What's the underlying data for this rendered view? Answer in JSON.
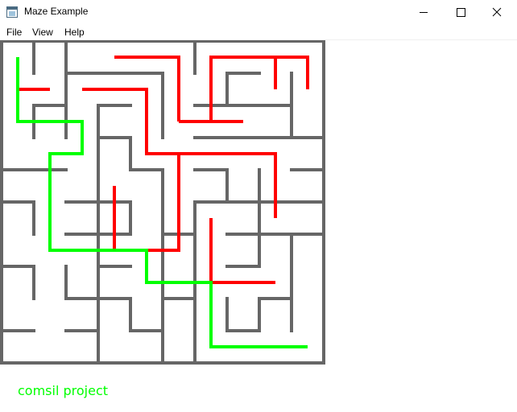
{
  "window": {
    "title": "Maze Example",
    "controls": {
      "minimize": "minimize",
      "maximize": "maximize",
      "close": "close"
    }
  },
  "menu": {
    "file": "File",
    "view": "View",
    "help": "Help"
  },
  "footer": {
    "text": "comsil project"
  },
  "colors": {
    "wall": "#666666",
    "solution_path": "#00ff00",
    "explored_path": "#ff0000",
    "footer_text": "#00ff00"
  },
  "maze": {
    "rows": 10,
    "cols": 10,
    "solution_path": [
      [
        0,
        0
      ],
      [
        0,
        1
      ],
      [
        0,
        2
      ],
      [
        1,
        2
      ],
      [
        2,
        2
      ],
      [
        2,
        3
      ],
      [
        1,
        3
      ],
      [
        1,
        4
      ],
      [
        1,
        5
      ],
      [
        1,
        6
      ],
      [
        2,
        6
      ],
      [
        3,
        6
      ],
      [
        4,
        6
      ],
      [
        4,
        7
      ],
      [
        5,
        7
      ],
      [
        6,
        7
      ],
      [
        6,
        8
      ],
      [
        6,
        9
      ],
      [
        7,
        9
      ],
      [
        8,
        9
      ],
      [
        9,
        9
      ]
    ],
    "explored_segments": [
      [
        [
          0,
          1
        ],
        [
          1,
          1
        ]
      ],
      [
        [
          2,
          1
        ],
        [
          3,
          1
        ],
        [
          4,
          1
        ],
        [
          4,
          2
        ],
        [
          4,
          3
        ],
        [
          5,
          3
        ],
        [
          6,
          3
        ],
        [
          7,
          3
        ],
        [
          8,
          3
        ],
        [
          8,
          4
        ],
        [
          8,
          5
        ]
      ],
      [
        [
          5,
          3
        ],
        [
          5,
          4
        ],
        [
          5,
          5
        ],
        [
          5,
          6
        ],
        [
          4,
          6
        ],
        [
          4,
          7
        ]
      ],
      [
        [
          3,
          4
        ],
        [
          3,
          5
        ],
        [
          3,
          6
        ]
      ],
      [
        [
          5,
          2
        ],
        [
          6,
          2
        ],
        [
          6,
          1
        ],
        [
          6,
          0
        ],
        [
          7,
          0
        ],
        [
          8,
          0
        ]
      ],
      [
        [
          5,
          1
        ],
        [
          5,
          0
        ],
        [
          4,
          0
        ],
        [
          3,
          0
        ]
      ],
      [
        [
          8,
          0
        ],
        [
          8,
          1
        ]
      ],
      [
        [
          5,
          1
        ],
        [
          5,
          2
        ]
      ],
      [
        [
          6,
          0
        ],
        [
          9,
          0
        ],
        [
          9,
          1
        ]
      ],
      [
        [
          5,
          2
        ],
        [
          7,
          2
        ]
      ],
      [
        [
          6,
          7
        ],
        [
          6,
          6
        ],
        [
          6,
          5
        ]
      ],
      [
        [
          6,
          7
        ],
        [
          8,
          7
        ]
      ]
    ],
    "walls": [
      [
        [
          0,
          0
        ],
        [
          10,
          0
        ]
      ],
      [
        [
          0,
          10
        ],
        [
          10,
          10
        ]
      ],
      [
        [
          0,
          0
        ],
        [
          0,
          10
        ]
      ],
      [
        [
          10,
          0
        ],
        [
          10,
          10
        ]
      ],
      [
        [
          1,
          0
        ],
        [
          1,
          1
        ]
      ],
      [
        [
          2,
          0
        ],
        [
          2,
          3
        ]
      ],
      [
        [
          2,
          1
        ],
        [
          5,
          1
        ]
      ],
      [
        [
          3,
          2
        ],
        [
          3,
          10
        ]
      ],
      [
        [
          1,
          2
        ],
        [
          2,
          2
        ]
      ],
      [
        [
          1,
          2
        ],
        [
          1,
          3
        ]
      ],
      [
        [
          3,
          2
        ],
        [
          4,
          2
        ]
      ],
      [
        [
          5,
          1
        ],
        [
          5,
          3
        ]
      ],
      [
        [
          6,
          0
        ],
        [
          6,
          1
        ]
      ],
      [
        [
          7,
          1
        ],
        [
          8,
          1
        ]
      ],
      [
        [
          7,
          1
        ],
        [
          7,
          2
        ]
      ],
      [
        [
          6,
          2
        ],
        [
          9,
          2
        ]
      ],
      [
        [
          9,
          1
        ],
        [
          9,
          3
        ]
      ],
      [
        [
          6,
          3
        ],
        [
          10,
          3
        ]
      ],
      [
        [
          3,
          3
        ],
        [
          4,
          3
        ]
      ],
      [
        [
          4,
          3
        ],
        [
          4,
          4
        ]
      ],
      [
        [
          0,
          4
        ],
        [
          2,
          4
        ]
      ],
      [
        [
          2,
          5
        ],
        [
          4,
          5
        ]
      ],
      [
        [
          4,
          4
        ],
        [
          5,
          4
        ]
      ],
      [
        [
          5,
          4
        ],
        [
          5,
          10
        ]
      ],
      [
        [
          6,
          4
        ],
        [
          7,
          4
        ]
      ],
      [
        [
          7,
          4
        ],
        [
          7,
          5
        ]
      ],
      [
        [
          6,
          5
        ],
        [
          9,
          5
        ]
      ],
      [
        [
          8,
          4
        ],
        [
          8,
          7
        ]
      ],
      [
        [
          9,
          4
        ],
        [
          10,
          4
        ]
      ],
      [
        [
          9,
          5
        ],
        [
          10,
          5
        ]
      ],
      [
        [
          6,
          5
        ],
        [
          6,
          8
        ]
      ],
      [
        [
          0,
          5
        ],
        [
          1,
          5
        ]
      ],
      [
        [
          1,
          5
        ],
        [
          1,
          6
        ]
      ],
      [
        [
          2,
          6
        ],
        [
          4,
          6
        ]
      ],
      [
        [
          4,
          5
        ],
        [
          4,
          6
        ]
      ],
      [
        [
          5,
          6
        ],
        [
          6,
          6
        ]
      ],
      [
        [
          5,
          6
        ],
        [
          5,
          7
        ]
      ],
      [
        [
          7,
          6
        ],
        [
          10,
          6
        ]
      ],
      [
        [
          7,
          7
        ],
        [
          8,
          7
        ]
      ],
      [
        [
          9,
          6
        ],
        [
          9,
          9
        ]
      ],
      [
        [
          0,
          7
        ],
        [
          1,
          7
        ]
      ],
      [
        [
          1,
          7
        ],
        [
          1,
          8
        ]
      ],
      [
        [
          2,
          7
        ],
        [
          2,
          8
        ]
      ],
      [
        [
          3,
          7
        ],
        [
          4,
          7
        ]
      ],
      [
        [
          3,
          7
        ],
        [
          3,
          8
        ]
      ],
      [
        [
          2,
          8
        ],
        [
          4,
          8
        ]
      ],
      [
        [
          4,
          8
        ],
        [
          4,
          9
        ]
      ],
      [
        [
          4,
          9
        ],
        [
          5,
          9
        ]
      ],
      [
        [
          5,
          8
        ],
        [
          6,
          8
        ]
      ],
      [
        [
          6,
          8
        ],
        [
          6,
          10
        ]
      ],
      [
        [
          7,
          8
        ],
        [
          7,
          9
        ]
      ],
      [
        [
          8,
          8
        ],
        [
          9,
          8
        ]
      ],
      [
        [
          8,
          8
        ],
        [
          8,
          9
        ]
      ],
      [
        [
          7,
          9
        ],
        [
          8,
          9
        ]
      ],
      [
        [
          0,
          9
        ],
        [
          1,
          9
        ]
      ],
      [
        [
          2,
          9
        ],
        [
          3,
          9
        ]
      ],
      [
        [
          3,
          9
        ],
        [
          3,
          10
        ]
      ]
    ]
  }
}
